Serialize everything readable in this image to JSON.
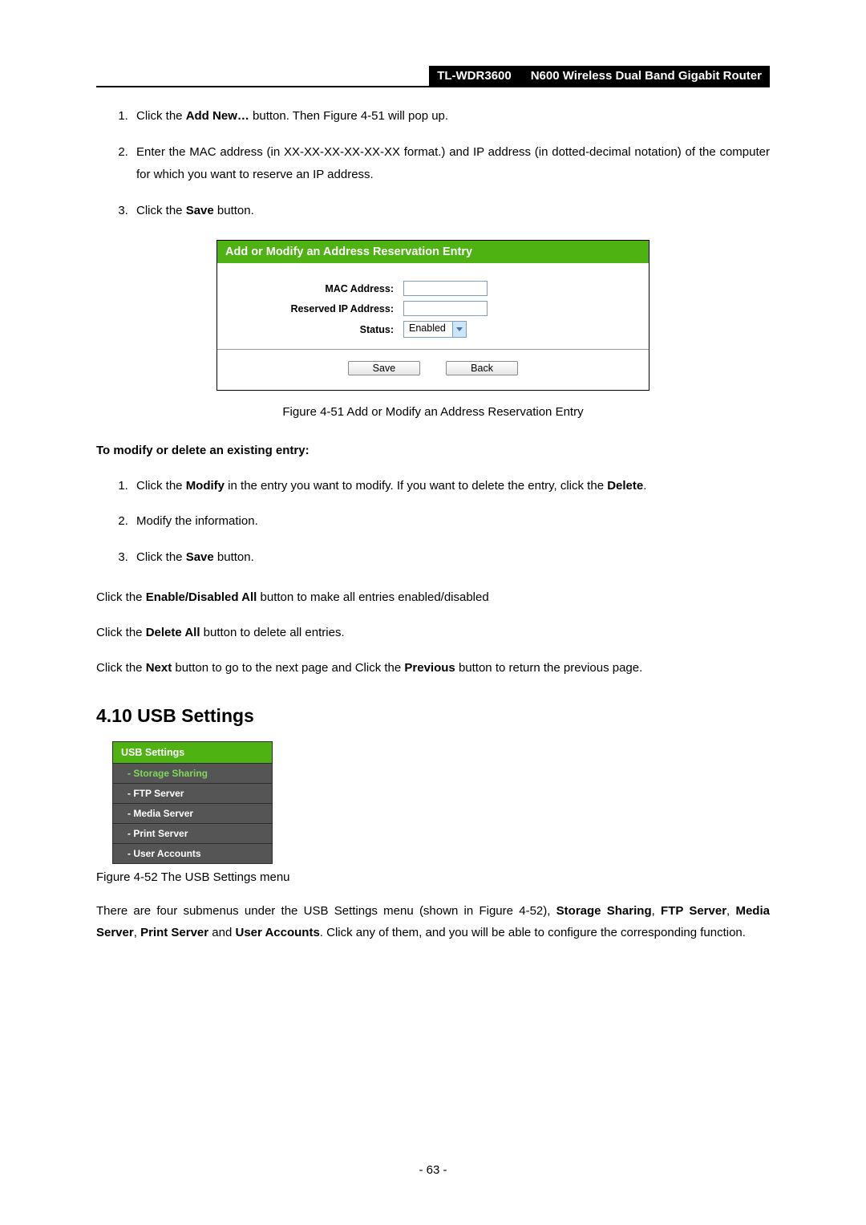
{
  "header": {
    "model": "TL-WDR3600",
    "product": "N600 Wireless Dual Band Gigabit Router"
  },
  "steps1": {
    "s1a": "Click the ",
    "s1b": "Add New…",
    "s1c": " button. Then Figure 4-51 will pop up.",
    "s2": "Enter the MAC address (in XX-XX-XX-XX-XX-XX format.) and IP address (in dotted-decimal notation) of the computer for which you want to reserve an IP address.",
    "s3a": "Click the ",
    "s3b": "Save",
    "s3c": " button."
  },
  "fig451": {
    "title": "Add or Modify an Address Reservation Entry",
    "lbl_mac": "MAC Address:",
    "lbl_ip": "Reserved IP Address:",
    "lbl_status": "Status:",
    "status_value": "Enabled",
    "btn_save": "Save",
    "btn_back": "Back",
    "caption": "Figure 4-51 Add or Modify an Address Reservation Entry"
  },
  "modify_heading": "To modify or delete an existing entry:",
  "steps2": {
    "s1a": "Click the ",
    "s1b": "Modify",
    "s1c": " in the entry you want to modify. If you want to delete the entry, click the ",
    "s1d": "Delete",
    "s1e": ".",
    "s2": "Modify the information.",
    "s3a": "Click the ",
    "s3b": "Save",
    "s3c": " button."
  },
  "p1": {
    "a": "Click the ",
    "b": "Enable/Disabled All",
    "c": " button to make all entries enabled/disabled"
  },
  "p2": {
    "a": "Click the ",
    "b": "Delete All",
    "c": " button to delete all entries."
  },
  "p3": {
    "a": "Click the ",
    "b": "Next",
    "c": " button to go to the next page and Click the ",
    "d": "Previous",
    "e": " button to return the previous page."
  },
  "section_heading": "4.10  USB Settings",
  "menu": {
    "hdr": "USB Settings",
    "items": [
      "- Storage Sharing",
      "- FTP Server",
      "- Media Server",
      "- Print Server",
      "- User Accounts"
    ]
  },
  "fig452_caption": "Figure 4-52 The USB Settings menu",
  "p4": {
    "a": "There are four submenus under the USB Settings menu (shown in Figure 4-52), ",
    "b": "Storage Sharing",
    "c": ", ",
    "d": "FTP Server",
    "e": ", ",
    "f": "Media Server",
    "g": ", ",
    "h": "Print Server",
    "i": " and ",
    "j": "User Accounts",
    "k": ". Click any of them, and you will be able to configure the corresponding function."
  },
  "page_number": "- 63 -"
}
